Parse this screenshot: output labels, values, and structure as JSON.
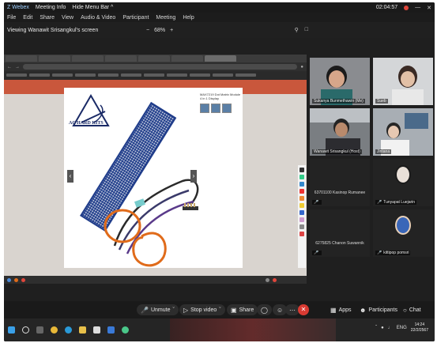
{
  "topbar": {
    "app_name": "Z Webex",
    "meeting_info": "Meeting Info",
    "hide_menu": "Hide Menu Bar ^",
    "timer": "02:04:57",
    "minimize": "—",
    "close": "✕"
  },
  "menubar": {
    "items": [
      "File",
      "Edit",
      "Share",
      "View",
      "Audio & Video",
      "Participant",
      "Meeting",
      "Help"
    ]
  },
  "viewbar": {
    "viewing_label": "Viewing Wanawit Srisangkul's screen",
    "zoom_minus": "−",
    "zoom_value": "68%",
    "zoom_plus": "+"
  },
  "shared": {
    "logo_text": "AC HARD KITS",
    "product_title_small": "MAX7219 Dot Matrix Module 4 in 1 Display"
  },
  "gallery": {
    "tiles": [
      {
        "name": "Sukanya Bunmethawin (Me)"
      },
      {
        "name": "Sueb"
      },
      {
        "name": "Wanawit Srisangkul (Host)"
      },
      {
        "name": "Jintana"
      },
      {
        "name": "63701100 Kasinop Rumanee",
        "mic_muted": true
      },
      {
        "name": "Tunyapat Luejarin",
        "mic_muted": true
      },
      {
        "name": "6275825 Chanon Suwannik",
        "mic_muted": true
      },
      {
        "name": "kittipop pomsri",
        "mic_muted": true
      }
    ]
  },
  "controls": {
    "unmute": "Unmute",
    "stop_video": "Stop video",
    "share": "Share",
    "apps": "Apps",
    "participants": "Participants",
    "chat": "Chat",
    "end_icon": "✕"
  },
  "taskbar": {
    "time": "14:24",
    "date": "22/2/2567",
    "lang": "ENG"
  },
  "colors": {
    "accent_red": "#e0463b",
    "zoom_bg": "#1f1f1f",
    "annotation_orange": "#e06b1a"
  }
}
